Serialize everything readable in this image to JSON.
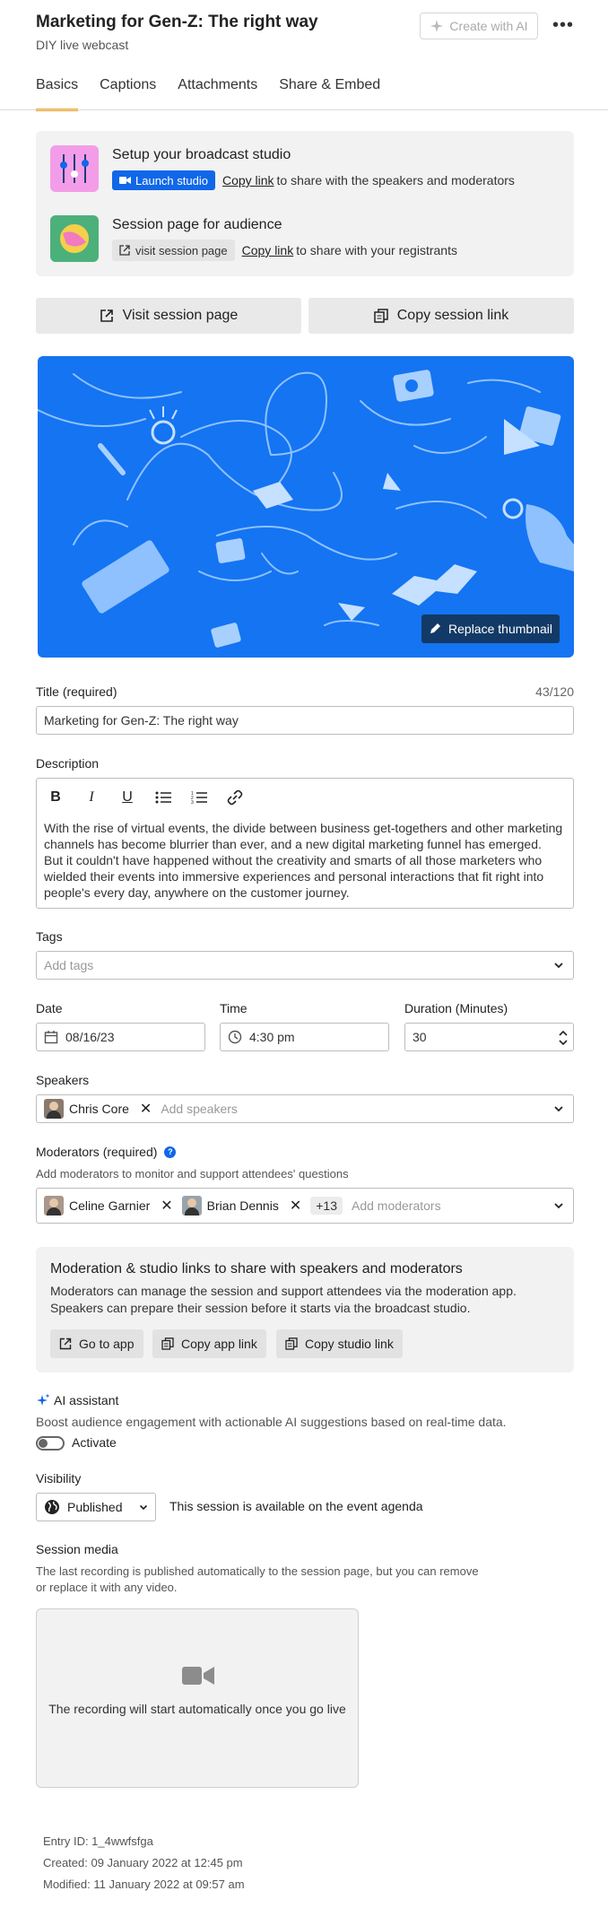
{
  "header": {
    "title": "Marketing for Gen-Z: The right way",
    "subtitle": "DIY live webcast",
    "create_ai_label": "Create with AI",
    "more_label": "•••"
  },
  "tabs": [
    {
      "label": "Basics",
      "active": true
    },
    {
      "label": "Captions",
      "active": false
    },
    {
      "label": "Attachments",
      "active": false
    },
    {
      "label": "Share & Embed",
      "active": false
    }
  ],
  "studio": {
    "title": "Setup your broadcast studio",
    "launch_label": "Launch studio",
    "copy_link_label": "Copy link",
    "share_text": "to share with the speakers and moderators"
  },
  "session_page": {
    "title": "Session page for audience",
    "visit_label": "visit session page",
    "copy_link_label": "Copy link",
    "share_text": "to share with your registrants"
  },
  "actions": {
    "visit_label": "Visit session page",
    "copy_label": "Copy session link"
  },
  "thumbnail": {
    "replace_label": "Replace thumbnail"
  },
  "title_field": {
    "label": "Title (required)",
    "counter": "43/120",
    "value": "Marketing for Gen-Z: The right way"
  },
  "description": {
    "label": "Description",
    "text": "With the rise of virtual events, the divide between business get-togethers and other marketing channels has become blurrier than ever, and a new digital marketing funnel has emerged.\nBut it couldn't have happened without the creativity and smarts of all those marketers who wielded their events into immersive experiences and personal interactions that fit right into people's every day, anywhere on the customer journey."
  },
  "tags": {
    "label": "Tags",
    "placeholder": "Add tags"
  },
  "date": {
    "label": "Date",
    "value": "08/16/23"
  },
  "time": {
    "label": "Time",
    "value": "4:30 pm"
  },
  "duration": {
    "label": "Duration (Minutes)",
    "value": "30"
  },
  "speakers": {
    "label": "Speakers",
    "chips": [
      "Chris Core"
    ],
    "placeholder": "Add speakers"
  },
  "moderators": {
    "label": "Moderators (required)",
    "help": "Add moderators to monitor and support attendees' questions",
    "chips": [
      "Celine Garnier",
      "Brian Dennis"
    ],
    "more": "+13",
    "placeholder": "Add moderators"
  },
  "mod_links": {
    "title": "Moderation & studio links to share with speakers and moderators",
    "desc": "Moderators can manage the session and support attendees via the moderation app. Speakers can prepare their session before it starts via the broadcast studio.",
    "go_label": "Go to app",
    "copy_app_label": "Copy app link",
    "copy_studio_label": "Copy studio link"
  },
  "ai": {
    "title": "AI assistant",
    "desc": "Boost audience engagement with actionable AI suggestions based on real-time data.",
    "toggle_label": "Activate"
  },
  "visibility": {
    "label": "Visibility",
    "value": "Published",
    "note": "This session is available on the event agenda"
  },
  "media": {
    "label": "Session media",
    "desc": "The last recording is published automatically to the session page, but you can remove or replace it with any video.",
    "placeholder": "The recording will start automatically once you go live"
  },
  "meta": {
    "entry_id": "Entry ID: 1_4wwfsfga",
    "created": "Created: 09 January 2022 at 12:45 pm",
    "modified": "Modified: 11 January 2022 at 09:57 am"
  },
  "colors": {
    "accent": "#1067e8",
    "tab_underline": "#f2a622",
    "thumbnail_bg": "#1474f2"
  }
}
